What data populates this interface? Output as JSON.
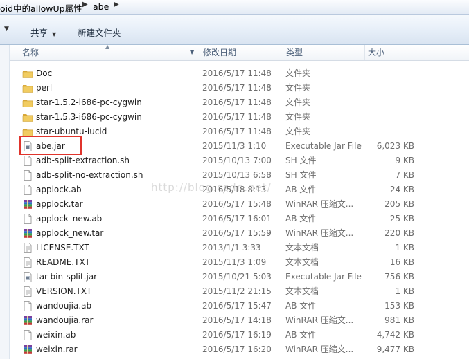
{
  "address_bar": {
    "segments": [
      "oid中的allowUp属性",
      "abe"
    ]
  },
  "toolbar": {
    "share_label": "共享",
    "new_folder_label": "新建文件夹"
  },
  "columns": {
    "name": "名称",
    "date": "修改日期",
    "type": "类型",
    "size": "大小"
  },
  "files": [
    {
      "name": "Doc",
      "date": "2016/5/17 11:48",
      "type": "文件夹",
      "size": "",
      "icon": "folder-icon"
    },
    {
      "name": "perl",
      "date": "2016/5/17 11:48",
      "type": "文件夹",
      "size": "",
      "icon": "folder-icon"
    },
    {
      "name": "star-1.5.2-i686-pc-cygwin",
      "date": "2016/5/17 11:48",
      "type": "文件夹",
      "size": "",
      "icon": "folder-icon"
    },
    {
      "name": "star-1.5.3-i686-pc-cygwin",
      "date": "2016/5/17 11:48",
      "type": "文件夹",
      "size": "",
      "icon": "folder-icon"
    },
    {
      "name": "star-ubuntu-lucid",
      "date": "2016/5/17 11:48",
      "type": "文件夹",
      "size": "",
      "icon": "folder-icon"
    },
    {
      "name": "abe.jar",
      "date": "2015/11/3 1:10",
      "type": "Executable Jar File",
      "size": "6,023 KB",
      "icon": "jar-file-icon"
    },
    {
      "name": "adb-split-extraction.sh",
      "date": "2015/10/13 7:00",
      "type": "SH 文件",
      "size": "9 KB",
      "icon": "file-icon"
    },
    {
      "name": "adb-split-no-extraction.sh",
      "date": "2015/10/13 6:58",
      "type": "SH 文件",
      "size": "7 KB",
      "icon": "file-icon"
    },
    {
      "name": "applock.ab",
      "date": "2016/5/18 8:13",
      "type": "AB 文件",
      "size": "24 KB",
      "icon": "file-icon"
    },
    {
      "name": "applock.tar",
      "date": "2016/5/17 15:48",
      "type": "WinRAR 压缩文...",
      "size": "205 KB",
      "icon": "winrar-archive-icon"
    },
    {
      "name": "applock_new.ab",
      "date": "2016/5/17 16:01",
      "type": "AB 文件",
      "size": "25 KB",
      "icon": "file-icon"
    },
    {
      "name": "applock_new.tar",
      "date": "2016/5/17 15:59",
      "type": "WinRAR 压缩文...",
      "size": "220 KB",
      "icon": "winrar-archive-icon"
    },
    {
      "name": "LICENSE.TXT",
      "date": "2013/1/1 3:33",
      "type": "文本文档",
      "size": "1 KB",
      "icon": "text-file-icon"
    },
    {
      "name": "README.TXT",
      "date": "2015/11/3 1:09",
      "type": "文本文档",
      "size": "16 KB",
      "icon": "text-file-icon"
    },
    {
      "name": "tar-bin-split.jar",
      "date": "2015/10/21 5:03",
      "type": "Executable Jar File",
      "size": "756 KB",
      "icon": "jar-file-icon"
    },
    {
      "name": "VERSION.TXT",
      "date": "2015/11/2 21:15",
      "type": "文本文档",
      "size": "1 KB",
      "icon": "text-file-icon"
    },
    {
      "name": "wandoujia.ab",
      "date": "2016/5/17 15:47",
      "type": "AB 文件",
      "size": "153 KB",
      "icon": "file-icon"
    },
    {
      "name": "wandoujia.rar",
      "date": "2016/5/17 14:18",
      "type": "WinRAR 压缩文...",
      "size": "981 KB",
      "icon": "winrar-archive-icon"
    },
    {
      "name": "weixin.ab",
      "date": "2016/5/17 16:19",
      "type": "AB 文件",
      "size": "4,742 KB",
      "icon": "file-icon"
    },
    {
      "name": "weixin.rar",
      "date": "2016/5/17 16:20",
      "type": "WinRAR 压缩文...",
      "size": "9,477 KB",
      "icon": "winrar-archive-icon"
    }
  ],
  "watermark": "http://blog.csdn.net/",
  "colors": {
    "highlight_box": "#e0342c",
    "folder": "#e8c35a"
  }
}
